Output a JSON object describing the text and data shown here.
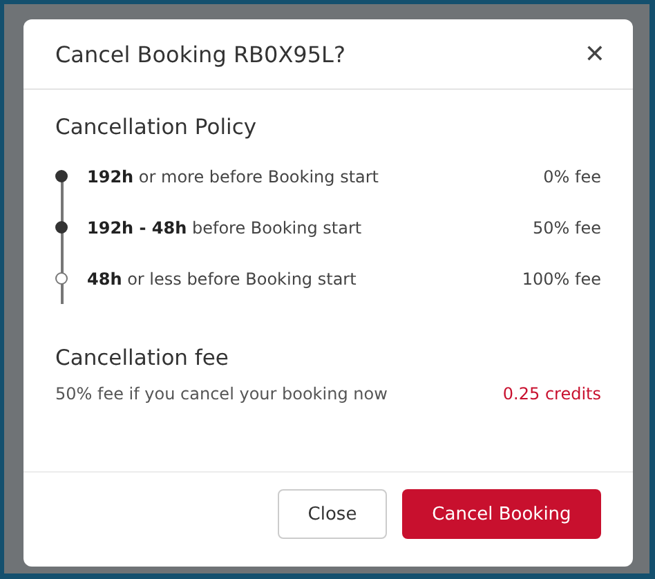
{
  "dialog": {
    "title": "Cancel Booking RB0X95L?",
    "close_icon": "✕"
  },
  "policy": {
    "heading": "Cancellation Policy",
    "tiers": [
      {
        "period": "**192h** or more before Booking start",
        "fee": "0% fee",
        "filled": true
      },
      {
        "period": "**192h - 48h** before Booking start",
        "fee": "50% fee",
        "filled": true
      },
      {
        "period": "**48h** or less before Booking start",
        "fee": "100% fee",
        "filled": false
      }
    ]
  },
  "fee": {
    "heading": "Cancellation fee",
    "description": "50% fee if you cancel your booking now",
    "amount": "0.25 credits"
  },
  "buttons": [
    {
      "label": "Close",
      "kind": "secondary"
    },
    {
      "label": "Cancel Booking",
      "kind": "primary"
    }
  ]
}
